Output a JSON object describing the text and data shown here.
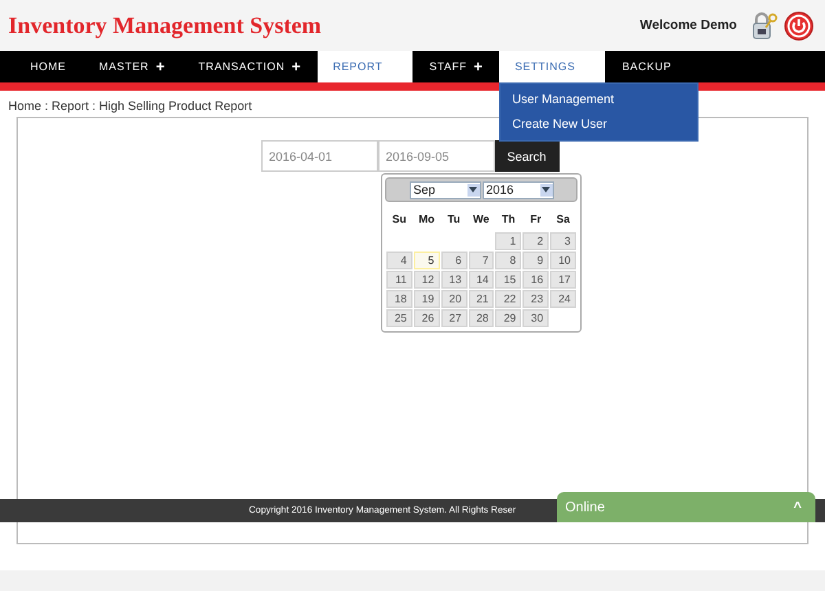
{
  "header": {
    "title": "Inventory Management System",
    "welcome": "Welcome Demo"
  },
  "nav": [
    {
      "label": "HOME",
      "selected": false
    },
    {
      "label": "MASTER",
      "submenu_mark": "+",
      "selected": false
    },
    {
      "label": "TRANSACTION",
      "submenu_mark": "+",
      "selected": false
    },
    {
      "label": "REPORT",
      "selected": true
    },
    {
      "label": "STAFF",
      "submenu_mark": "+",
      "selected": false
    },
    {
      "label": "SETTINGS",
      "selected": true,
      "expanded": true,
      "submenu": [
        "User Management",
        "Create New User"
      ]
    },
    {
      "label": "BACKUP",
      "selected": false
    }
  ],
  "breadcrumb": "Home : Report : High Selling Product Report",
  "filter": {
    "from": "2016-04-01",
    "to": "2016-09-05",
    "button": "Search"
  },
  "datepicker": {
    "month": "Sep",
    "year": "2016",
    "weekdays": [
      "Su",
      "Mo",
      "Tu",
      "We",
      "Th",
      "Fr",
      "Sa"
    ],
    "weeks": [
      [
        {
          "kind": "blank"
        },
        {
          "kind": "blank"
        },
        {
          "kind": "blank"
        },
        {
          "kind": "blank"
        },
        {
          "label": "1",
          "selected": false
        },
        {
          "label": "2",
          "selected": false
        },
        {
          "label": "3",
          "selected": false
        }
      ],
      [
        {
          "label": "4",
          "selected": false
        },
        {
          "label": "5",
          "selected": true
        },
        {
          "label": "6",
          "selected": false
        },
        {
          "label": "7",
          "selected": false
        },
        {
          "label": "8",
          "selected": false
        },
        {
          "label": "9",
          "selected": false
        },
        {
          "label": "10",
          "selected": false
        }
      ],
      [
        {
          "label": "11",
          "selected": false
        },
        {
          "label": "12",
          "selected": false
        },
        {
          "label": "13",
          "selected": false
        },
        {
          "label": "14",
          "selected": false
        },
        {
          "label": "15",
          "selected": false
        },
        {
          "label": "16",
          "selected": false
        },
        {
          "label": "17",
          "selected": false
        }
      ],
      [
        {
          "label": "18",
          "selected": false
        },
        {
          "label": "19",
          "selected": false
        },
        {
          "label": "20",
          "selected": false
        },
        {
          "label": "21",
          "selected": false
        },
        {
          "label": "22",
          "selected": false
        },
        {
          "label": "23",
          "selected": false
        },
        {
          "label": "24",
          "selected": false
        }
      ],
      [
        {
          "label": "25",
          "selected": false
        },
        {
          "label": "26",
          "selected": false
        },
        {
          "label": "27",
          "selected": false
        },
        {
          "label": "28",
          "selected": false
        },
        {
          "label": "29",
          "selected": false
        },
        {
          "label": "30",
          "selected": false
        },
        {
          "kind": "blank"
        }
      ]
    ]
  },
  "footer": "Copyright 2016 Inventory Management System. All Rights Reser",
  "chat": {
    "label": "Online",
    "caret": "^"
  }
}
